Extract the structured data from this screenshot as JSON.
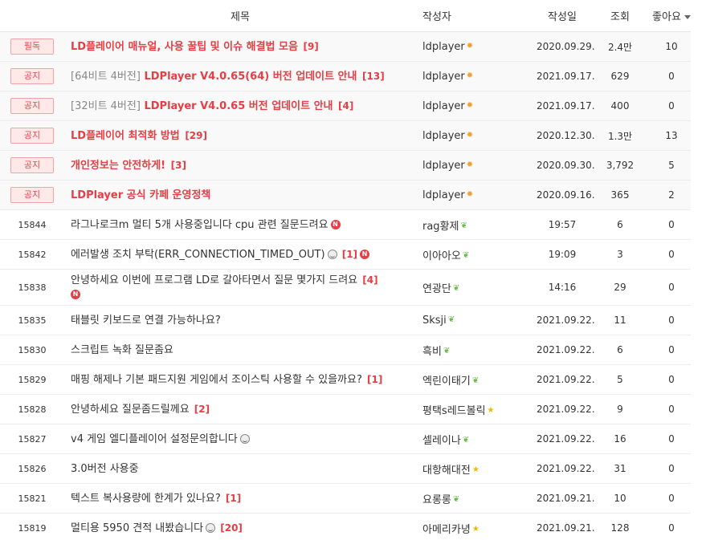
{
  "header": {
    "title": "제목",
    "author": "작성자",
    "date": "작성일",
    "views": "조회",
    "likes": "좋아요"
  },
  "notices": [
    {
      "badge": "필독",
      "prefix": "",
      "title": "LD플레이어 매뉴얼, 사용 꿀팁 및 이슈 해결법 모음",
      "comments": "[9]",
      "author": "ldplayer",
      "date": "2020.09.29.",
      "views": "2.4만",
      "likes": "10"
    },
    {
      "badge": "공지",
      "prefix": "[64비트 4버전]",
      "title": " LDPlayer V4.0.65(64) 버전 업데이트 안내",
      "comments": "[13]",
      "author": "ldplayer",
      "date": "2021.09.17.",
      "views": "629",
      "likes": "0"
    },
    {
      "badge": "공지",
      "prefix": "[32비트 4버전]",
      "title": " LDPlayer V4.0.65 버전 업데이트 안내",
      "comments": "[4]",
      "author": "ldplayer",
      "date": "2021.09.17.",
      "views": "400",
      "likes": "0"
    },
    {
      "badge": "공지",
      "prefix": "",
      "title": "LD플레이어 최적화 방법",
      "comments": "[29]",
      "author": "ldplayer",
      "date": "2020.12.30.",
      "views": "1.3만",
      "likes": "13"
    },
    {
      "badge": "공지",
      "prefix": "",
      "title": "개인정보는 안전하게!",
      "comments": "[3]",
      "author": "ldplayer",
      "date": "2020.09.30.",
      "views": "3,792",
      "likes": "5"
    },
    {
      "badge": "공지",
      "prefix": "",
      "title": "LDPlayer 공식 카페 운영정책",
      "comments": "",
      "author": "ldplayer",
      "date": "2020.09.16.",
      "views": "365",
      "likes": "2"
    }
  ],
  "posts": [
    {
      "num": "15844",
      "title": "라그나로크m 멀티 5개 사용중입니다 cpu 관련 질문드려요",
      "comments": "",
      "emoji": false,
      "new": true,
      "author": "rag황제",
      "level": "sprout",
      "date": "19:57",
      "views": "6",
      "likes": "0"
    },
    {
      "num": "15842",
      "title": "에러발생 조치 부탁(ERR_CONNECTION_TIMED_OUT)",
      "comments": "[1]",
      "emoji": true,
      "new": true,
      "author": "이아아오",
      "level": "sprout",
      "date": "19:09",
      "views": "3",
      "likes": "0"
    },
    {
      "num": "15838",
      "title": "안녕하세요 이번에 프로그램 LD로 갈아타면서 질문 몇가지 드려요",
      "comments": "[4]",
      "emoji": false,
      "new": true,
      "author": "연광단",
      "level": "sprout",
      "date": "14:16",
      "views": "29",
      "likes": "0"
    },
    {
      "num": "15835",
      "title": "태블릿 키보드로 연결 가능하나요?",
      "comments": "",
      "emoji": false,
      "new": false,
      "author": "Sksji",
      "level": "sprout",
      "date": "2021.09.22.",
      "views": "11",
      "likes": "0"
    },
    {
      "num": "15830",
      "title": "스크립트 녹화 질문좀요",
      "comments": "",
      "emoji": false,
      "new": false,
      "author": "흑비",
      "level": "sprout",
      "date": "2021.09.22.",
      "views": "6",
      "likes": "0"
    },
    {
      "num": "15829",
      "title": "매핑 해제나 기본 패드지원 게임에서 조이스틱 사용할 수 있을까요?",
      "comments": "[1]",
      "emoji": false,
      "new": false,
      "author": "엑린이태기",
      "level": "sprout",
      "date": "2021.09.22.",
      "views": "5",
      "likes": "0"
    },
    {
      "num": "15828",
      "title": "안녕하세요 질문좀드릴께요",
      "comments": "[2]",
      "emoji": false,
      "new": false,
      "author": "평택s레드볼릭",
      "level": "star",
      "date": "2021.09.22.",
      "views": "9",
      "likes": "0"
    },
    {
      "num": "15827",
      "title": "v4 게임 엘디플레이어 설정문의합니다",
      "comments": "",
      "emoji": true,
      "new": false,
      "author": "셀레이나",
      "level": "sprout",
      "date": "2021.09.22.",
      "views": "16",
      "likes": "0"
    },
    {
      "num": "15826",
      "title": "3.0버전 사용중",
      "comments": "",
      "emoji": false,
      "new": false,
      "author": "대항해대전",
      "level": "star",
      "date": "2021.09.22.",
      "views": "31",
      "likes": "0"
    },
    {
      "num": "15821",
      "title": "텍스트 복사용량에 한계가 있나요?",
      "comments": "[1]",
      "emoji": false,
      "new": false,
      "author": "요롱롱",
      "level": "sprout",
      "date": "2021.09.21.",
      "views": "10",
      "likes": "0"
    },
    {
      "num": "15819",
      "title": "멀티용 5950 견적 내봤습니다",
      "comments": "[20]",
      "emoji": true,
      "new": false,
      "author": "아메리카녕",
      "level": "star",
      "date": "2021.09.21.",
      "views": "128",
      "likes": "0"
    }
  ],
  "icons": {
    "new": "N",
    "level_sun": "sun-icon",
    "level_sprout": "sprout-icon",
    "level_star": "star-icon"
  },
  "colors": {
    "accent": "#e53e44",
    "badge_bg": "#ffe8e8",
    "notice_bg": "#f9f9f9"
  }
}
